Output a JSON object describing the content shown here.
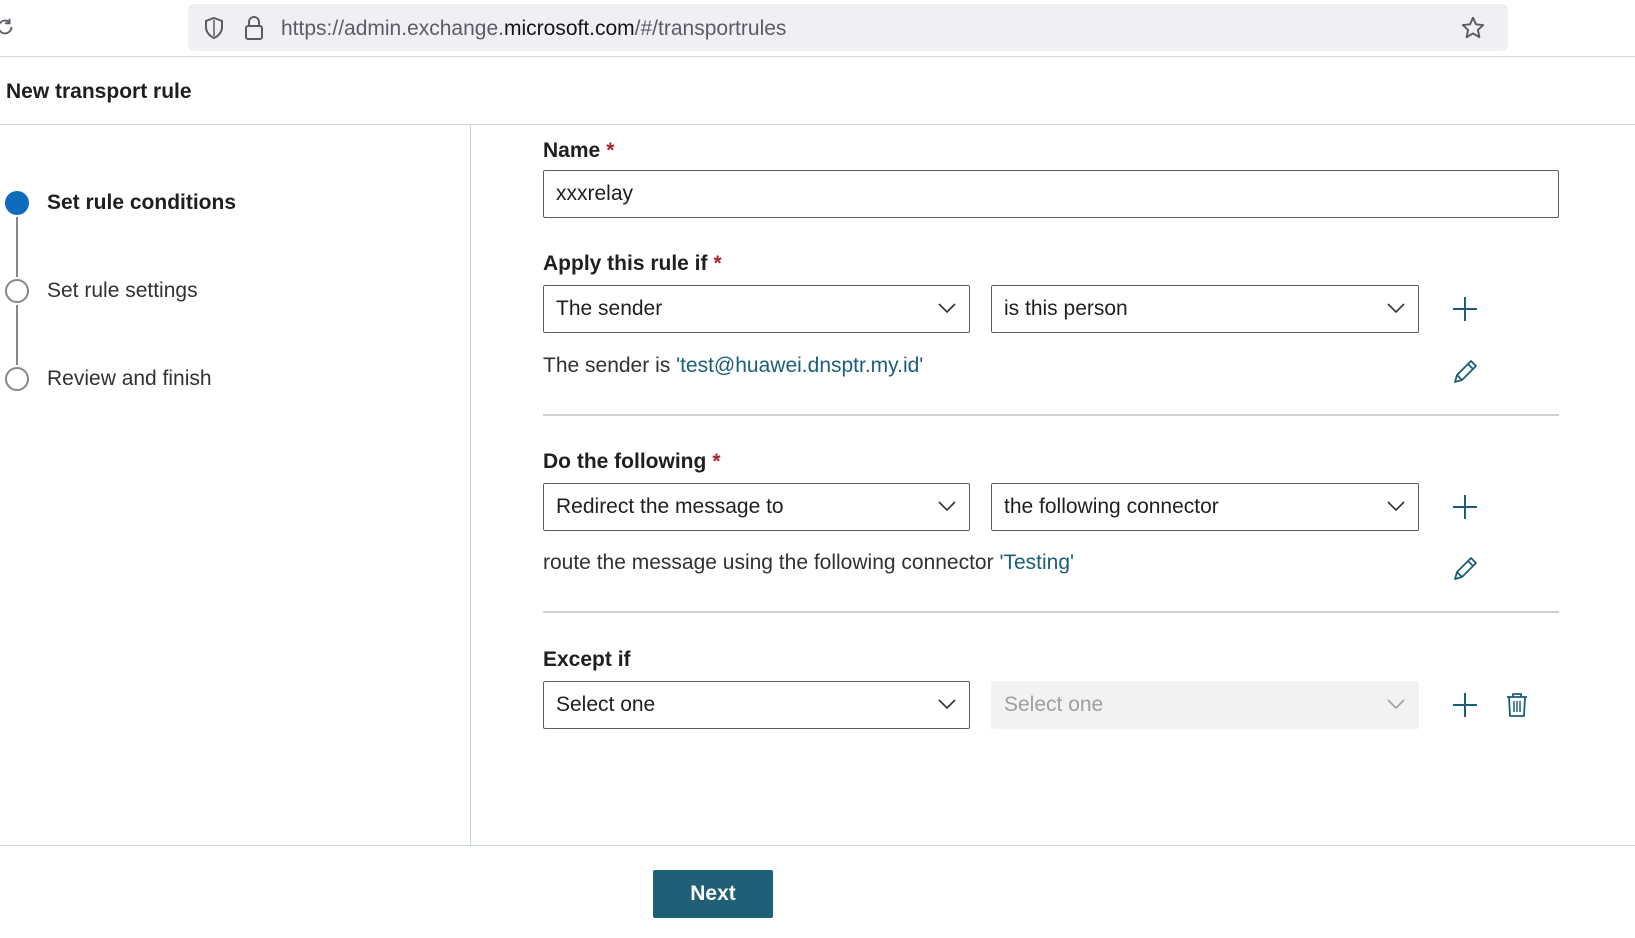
{
  "browser": {
    "url_prefix": "https://admin.exchange.",
    "url_host": "microsoft.com",
    "url_suffix": "/#/transportrules"
  },
  "header": {
    "title": "New transport rule"
  },
  "wizard": {
    "steps": [
      {
        "label": "Set rule conditions",
        "active": true
      },
      {
        "label": "Set rule settings",
        "active": false
      },
      {
        "label": "Review and finish",
        "active": false
      }
    ]
  },
  "form": {
    "name": {
      "label": "Name",
      "required": "*",
      "value": "xxxrelay"
    },
    "apply": {
      "label": "Apply this rule if",
      "required": "*",
      "select1": "The sender",
      "select2": "is this person",
      "summary_text": "The sender is ",
      "summary_link": "'test@huawei.dnsptr.my.id'"
    },
    "do": {
      "label": "Do the following",
      "required": "*",
      "select1": "Redirect the message to",
      "select2": "the following connector",
      "summary_text": "route the message using the following connector ",
      "summary_link": "'Testing'"
    },
    "except": {
      "label": "Except if",
      "select1": "Select one",
      "select2": "Select one"
    }
  },
  "footer": {
    "next_label": "Next"
  },
  "colors": {
    "accent": "#0f6cbd",
    "primary_button": "#1f5f78",
    "link": "#1b5e7a",
    "required": "#a4262c"
  }
}
